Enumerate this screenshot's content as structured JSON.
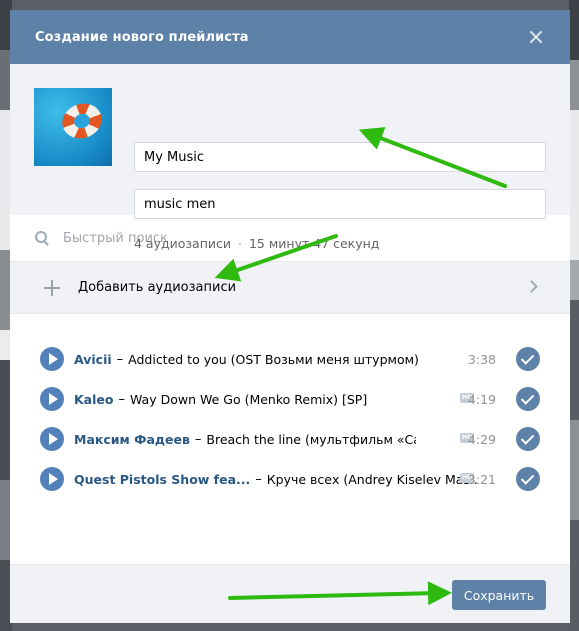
{
  "modal": {
    "title": "Создание нового плейлиста"
  },
  "playlist": {
    "name": "My Music",
    "description": "music men",
    "track_count": "4 аудиозаписи",
    "separator": "·",
    "total_duration": "15 минут 47 секунд"
  },
  "search": {
    "placeholder": "Быстрый поиск"
  },
  "add_tracks": {
    "label": "Добавить аудиозаписи"
  },
  "tracks": [
    {
      "artist": "Avicii",
      "title": "Addicted to you (OST Возьми меня штурмом)",
      "duration": "3:38",
      "hq": false
    },
    {
      "artist": "Kaleo",
      "title": "Way Down We Go (Menko Remix) [SP]",
      "duration": "4:19",
      "hq": true
    },
    {
      "artist": "Максим Фадеев",
      "title": "Breach the line (мультфильм «Савва.Се...",
      "duration": "4:29",
      "hq": true
    },
    {
      "artist": "Quest Pistols Show fea...",
      "title": "Круче всех (Andrey Kiselev Mas...",
      "duration": "3:21",
      "hq": true
    }
  ],
  "dash": "–",
  "hq_badge": "HQ",
  "footer": {
    "save_label": "Сохранить"
  },
  "colors": {
    "header": "#5e81a8",
    "accent": "#5181b8",
    "arrow": "#2eba0f"
  }
}
